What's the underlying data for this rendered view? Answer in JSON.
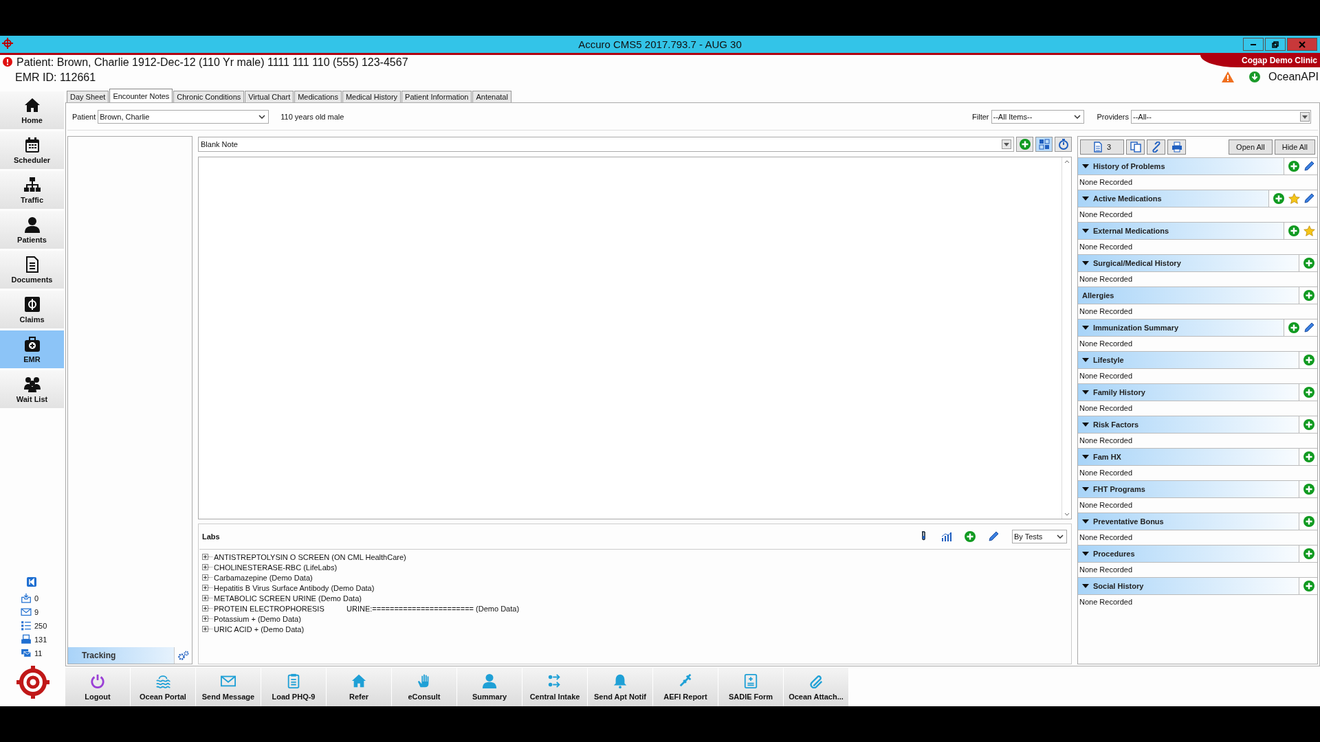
{
  "window": {
    "title": "Accuro CMS5 2017.793.7 - AUG 30",
    "clinic": "Cogap Demo Clinic"
  },
  "patient_header": {
    "summary": "Patient: Brown, Charlie 1912-Dec-12 (110 Yr male) 1111 111 110 (555) 123-4567",
    "emr_id": "EMR ID: 112661",
    "service": "OceanAPI"
  },
  "nav": [
    {
      "kind": "home",
      "label": "Home",
      "selected": false
    },
    {
      "kind": "calendar",
      "label": "Scheduler",
      "selected": false
    },
    {
      "kind": "hierarchy",
      "label": "Traffic",
      "selected": false
    },
    {
      "kind": "person",
      "label": "Patients",
      "selected": false
    },
    {
      "kind": "document",
      "label": "Documents",
      "selected": false
    },
    {
      "kind": "dollar",
      "label": "Claims",
      "selected": false
    },
    {
      "kind": "medkit",
      "label": "EMR",
      "selected": true
    },
    {
      "kind": "group",
      "label": "Wait List",
      "selected": false
    }
  ],
  "counters": [
    {
      "kind": "inbox",
      "value": "0"
    },
    {
      "kind": "mail",
      "value": "9"
    },
    {
      "kind": "list",
      "value": "250"
    },
    {
      "kind": "printer",
      "value": "131"
    },
    {
      "kind": "messages",
      "value": "11"
    }
  ],
  "tabs": [
    {
      "label": "Day Sheet",
      "selected": false
    },
    {
      "label": "Encounter Notes",
      "selected": true
    },
    {
      "label": "Chronic Conditions",
      "selected": false
    },
    {
      "label": "Virtual Chart",
      "selected": false
    },
    {
      "label": "Medications",
      "selected": false
    },
    {
      "label": "Medical History",
      "selected": false
    },
    {
      "label": "Patient Information",
      "selected": false
    },
    {
      "label": "Antenatal",
      "selected": false
    }
  ],
  "patient_row": {
    "label": "Patient",
    "value": "Brown, Charlie",
    "age": "110 years old male"
  },
  "filter": {
    "label": "Filter",
    "value": "--All Items--"
  },
  "providers": {
    "label": "Providers",
    "value": "--All--"
  },
  "note": {
    "title": "Blank Note"
  },
  "tracking": {
    "label": "Tracking"
  },
  "summary_toolbar": {
    "count": "3",
    "buttons": [
      "Open All",
      "Hide All"
    ]
  },
  "sections": [
    {
      "title": "History of Problems",
      "arrow": true,
      "actions": [
        {
          "kind": "add"
        },
        {
          "kind": "edit"
        }
      ],
      "body": "None Recorded"
    },
    {
      "title": "Active Medications",
      "arrow": true,
      "actions": [
        {
          "kind": "add"
        },
        {
          "kind": "star"
        },
        {
          "kind": "edit"
        }
      ],
      "body": "None Recorded"
    },
    {
      "title": "External Medications",
      "arrow": true,
      "actions": [
        {
          "kind": "add"
        },
        {
          "kind": "star"
        }
      ],
      "body": "None Recorded"
    },
    {
      "title": "Surgical/Medical History",
      "arrow": true,
      "actions": [
        {
          "kind": "add"
        }
      ],
      "body": "None Recorded"
    },
    {
      "title": "Allergies",
      "arrow": false,
      "actions": [
        {
          "kind": "add"
        }
      ],
      "body": "None Recorded"
    },
    {
      "title": "Immunization Summary",
      "arrow": true,
      "actions": [
        {
          "kind": "add"
        },
        {
          "kind": "edit"
        }
      ],
      "body": "None Recorded"
    },
    {
      "title": "Lifestyle",
      "arrow": true,
      "actions": [
        {
          "kind": "add"
        }
      ],
      "body": "None Recorded"
    },
    {
      "title": "Family History",
      "arrow": true,
      "actions": [
        {
          "kind": "add"
        }
      ],
      "body": "None Recorded"
    },
    {
      "title": "Risk Factors",
      "arrow": true,
      "actions": [
        {
          "kind": "add"
        }
      ],
      "body": "None Recorded"
    },
    {
      "title": "Fam HX",
      "arrow": true,
      "actions": [
        {
          "kind": "add"
        }
      ],
      "body": "None Recorded"
    },
    {
      "title": "FHT Programs",
      "arrow": true,
      "actions": [
        {
          "kind": "add"
        }
      ],
      "body": "None Recorded"
    },
    {
      "title": "Preventative Bonus",
      "arrow": true,
      "actions": [
        {
          "kind": "add"
        }
      ],
      "body": "None Recorded"
    },
    {
      "title": "Procedures",
      "arrow": true,
      "actions": [
        {
          "kind": "add"
        }
      ],
      "body": "None Recorded"
    },
    {
      "title": "Social History",
      "arrow": true,
      "actions": [
        {
          "kind": "add"
        }
      ],
      "body": "None Recorded"
    }
  ],
  "labs": {
    "title": "Labs",
    "view": "By Tests",
    "items": [
      {
        "name": "ANTISTREPTOLYSIN O SCREEN (ON CML HealthCare)"
      },
      {
        "name": "CHOLINESTERASE-RBC (LifeLabs)"
      },
      {
        "name": "Carbamazepine (Demo Data)"
      },
      {
        "name": "Hepatitis B Virus Surface Antibody (Demo Data)"
      },
      {
        "name": "METABOLIC SCREEN URINE (Demo Data)"
      },
      {
        "name": "PROTEIN ELECTROPHORESIS",
        "result": "URINE:======================= (Demo Data)"
      },
      {
        "name": "Potassium + (Demo Data)"
      },
      {
        "name": "URIC ACID + (Demo Data)"
      }
    ]
  },
  "toolbar": [
    {
      "kind": "power",
      "label": "Logout"
    },
    {
      "kind": "waves",
      "label": "Ocean Portal"
    },
    {
      "kind": "mail",
      "label": "Send Message"
    },
    {
      "kind": "clipboard",
      "label": "Load PHQ-9"
    },
    {
      "kind": "home",
      "label": "Refer"
    },
    {
      "kind": "hand",
      "label": "eConsult"
    },
    {
      "kind": "person",
      "label": "Summary"
    },
    {
      "kind": "arrows",
      "label": "Central Intake"
    },
    {
      "kind": "bell",
      "label": "Send Apt Notif"
    },
    {
      "kind": "syringe",
      "label": "AEFI Report"
    },
    {
      "kind": "form",
      "label": "SADIE Form"
    },
    {
      "kind": "clip",
      "label": "Ocean Attach..."
    }
  ]
}
